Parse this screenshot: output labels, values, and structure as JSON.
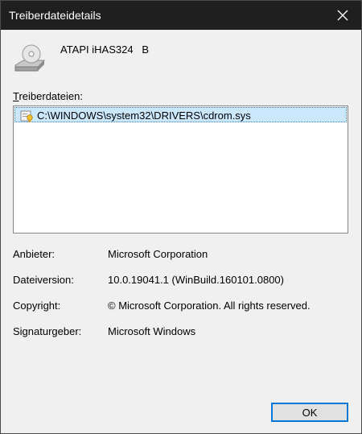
{
  "window": {
    "title": "Treiberdateidetails"
  },
  "device": {
    "name": "ATAPI iHAS324   B",
    "icon": "optical-drive-icon"
  },
  "files": {
    "label_mnemonic": "T",
    "label_rest": "reiberdateien:",
    "items": [
      {
        "path": "C:\\WINDOWS\\system32\\DRIVERS\\cdrom.sys",
        "icon": "signed-driver-file-icon"
      }
    ]
  },
  "properties": {
    "provider": {
      "label": "Anbieter:",
      "value": "Microsoft Corporation"
    },
    "file_version": {
      "label": "Dateiversion:",
      "value": "10.0.19041.1 (WinBuild.160101.0800)"
    },
    "copyright": {
      "label": "Copyright:",
      "value": "© Microsoft Corporation. All rights reserved."
    },
    "signer": {
      "label": "Signaturgeber:",
      "value": "Microsoft Windows"
    }
  },
  "buttons": {
    "ok": "OK"
  },
  "colors": {
    "titlebar": "#1f1f1f",
    "selection": "#cce8ff",
    "focus_border": "#0078d7"
  }
}
